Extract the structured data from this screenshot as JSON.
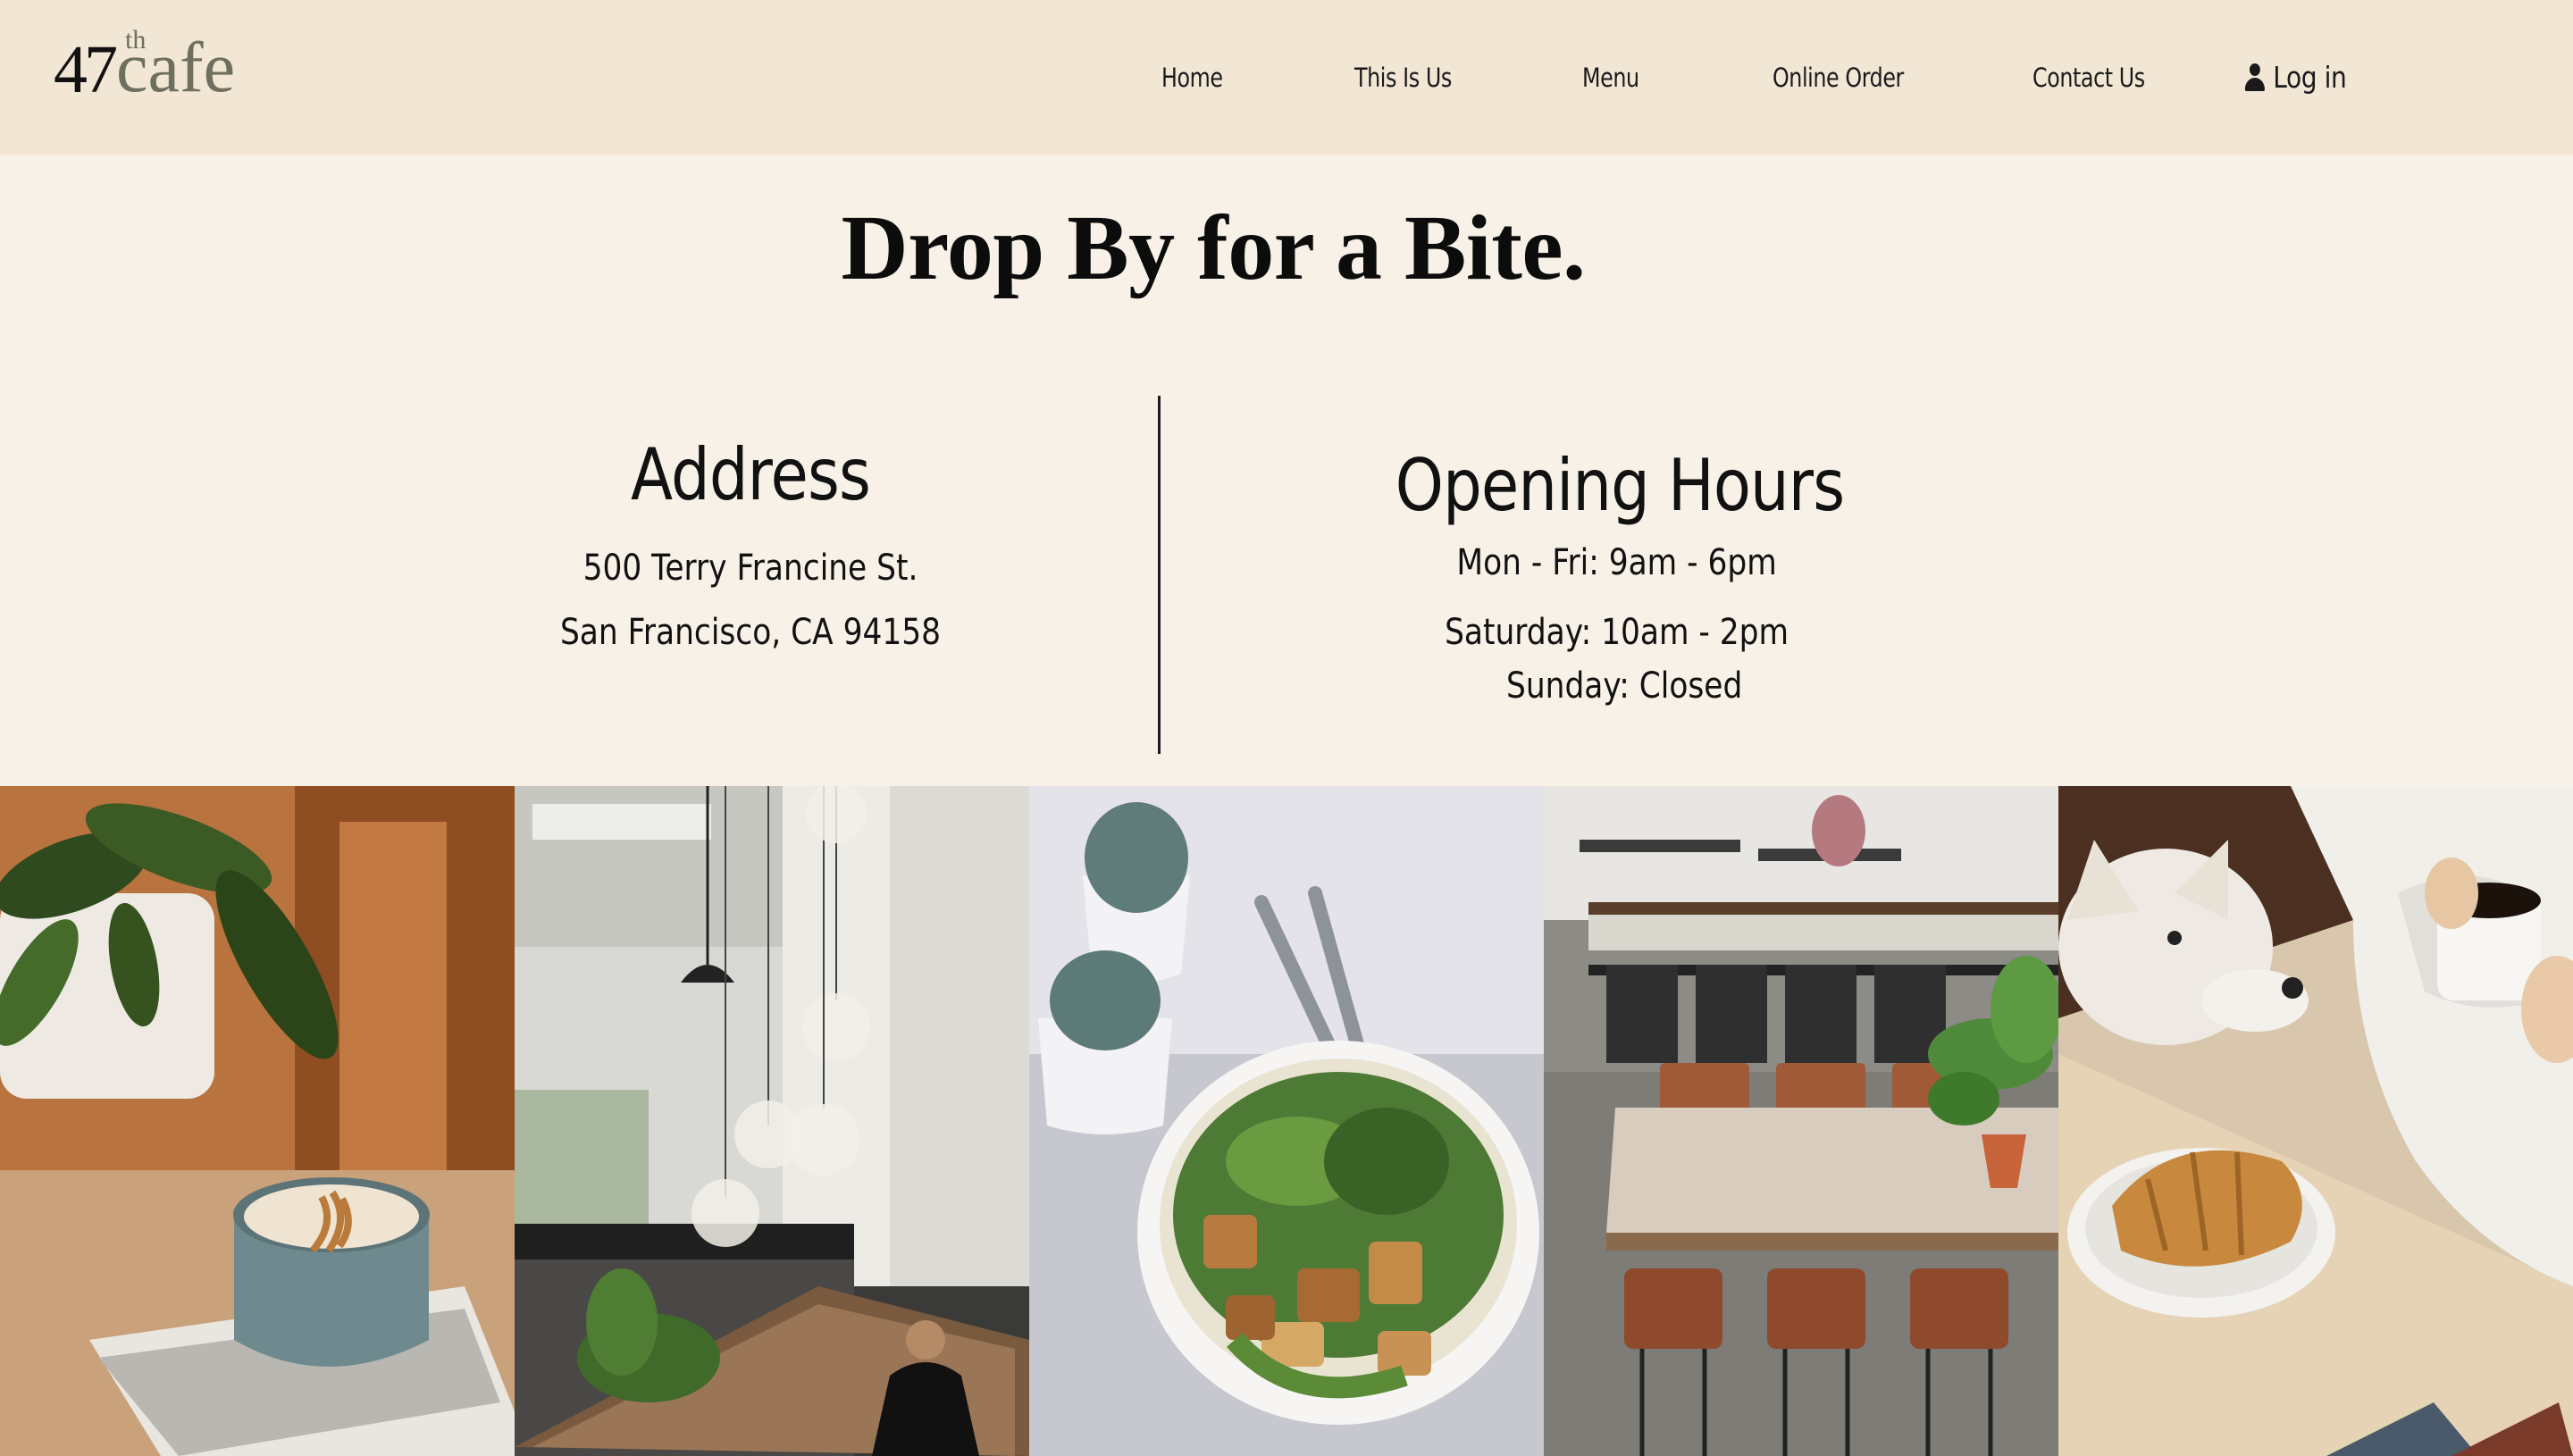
{
  "header": {
    "logo": {
      "number": "47",
      "superscript": "th",
      "word": "cafe"
    },
    "nav": [
      {
        "label": "Home"
      },
      {
        "label": "This Is Us"
      },
      {
        "label": "Menu"
      },
      {
        "label": "Online Order"
      },
      {
        "label": "Contact Us"
      }
    ],
    "login_label": "Log in"
  },
  "main": {
    "title": "Drop By for a Bite.",
    "address": {
      "heading": "Address",
      "line1": "500 Terry Francine St.",
      "line2": "San Francisco, CA 94158"
    },
    "hours": {
      "heading": "Opening Hours",
      "line1": "Mon - Fri: 9am - 6pm",
      "line2": "Saturday: 10am - 2pm",
      "line3": "Sunday: Closed"
    }
  },
  "gallery": {
    "photos": [
      {
        "subject": "latte-art-cup-plant"
      },
      {
        "subject": "cafe-interior-pendant-lights"
      },
      {
        "subject": "tofu-salad-bowl"
      },
      {
        "subject": "empty-cafe-tables"
      },
      {
        "subject": "dog-coffee-croissant"
      }
    ]
  },
  "colors": {
    "header_bg": "#f2e6d5",
    "page_bg": "#f8f1e7",
    "text": "#111111",
    "logo_accent": "#6f6f5f"
  }
}
